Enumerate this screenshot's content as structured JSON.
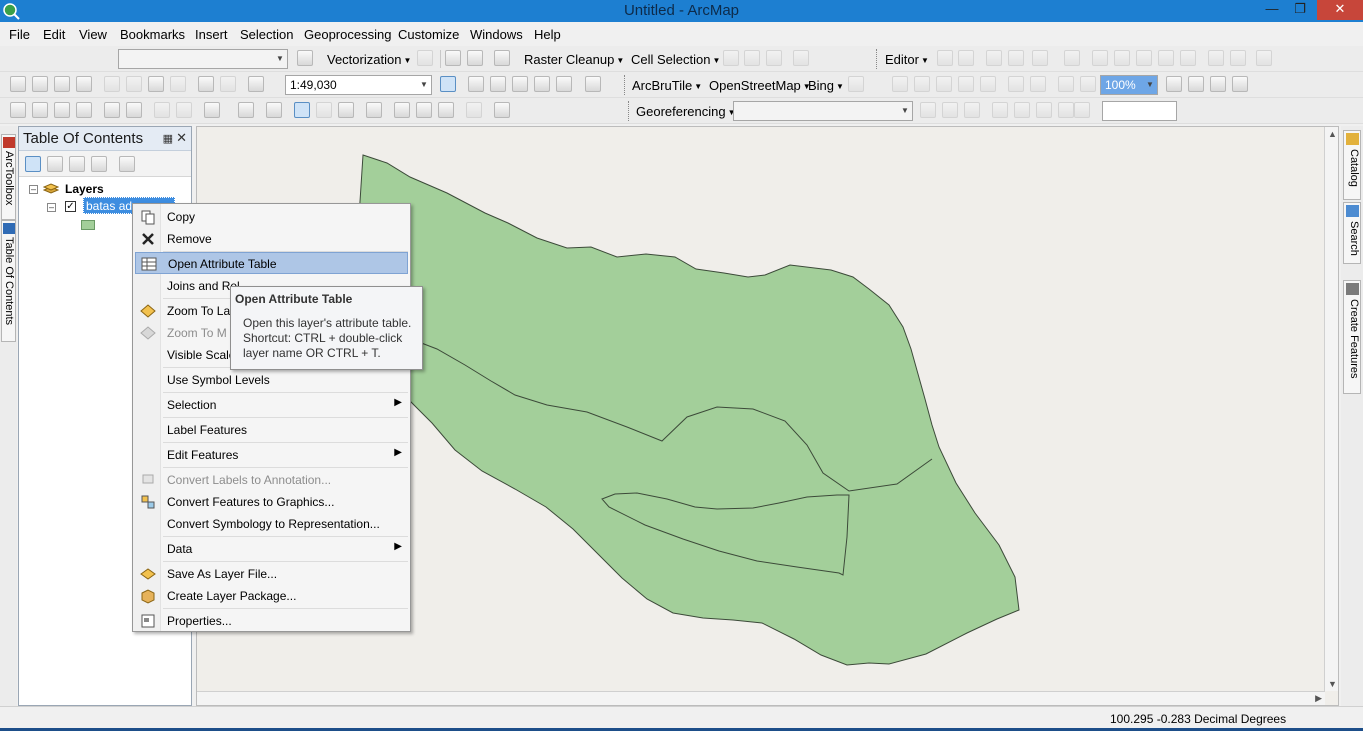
{
  "window": {
    "title": "Untitled - ArcMap"
  },
  "menu": [
    "File",
    "Edit",
    "View",
    "Bookmarks",
    "Insert",
    "Selection",
    "Geoprocessing",
    "Customize",
    "Windows",
    "Help"
  ],
  "toolbars": {
    "vectorization": "Vectorization",
    "raster_cleanup": "Raster Cleanup",
    "cell_selection": "Cell Selection",
    "editor": "Editor",
    "scale_value": "1:49,030",
    "arcbrutile": "ArcBruTile",
    "openstreetmap": "OpenStreetMap",
    "bing": "Bing",
    "zoom_percent": "100%",
    "georeferencing": "Georeferencing"
  },
  "left_tabs": [
    "ArcToolbox",
    "Table Of Contents"
  ],
  "toc": {
    "title": "Table Of Contents",
    "root": "Layers",
    "layer": "batas adm"
  },
  "right_tabs": [
    "Catalog",
    "Search",
    "Create Features"
  ],
  "context_menu": {
    "copy": "Copy",
    "remove": "Remove",
    "open_attribute_table": "Open Attribute Table",
    "joins": "Joins and Rel",
    "zoom_to_layer": "Zoom To La",
    "zoom_to_make_visible": "Zoom To M",
    "visible_scale": "Visible Scale",
    "use_symbol_levels": "Use Symbol Levels",
    "selection": "Selection",
    "label_features": "Label Features",
    "edit_features": "Edit Features",
    "convert_labels": "Convert Labels to Annotation...",
    "convert_features": "Convert Features to Graphics...",
    "convert_symbology": "Convert Symbology to Representation...",
    "data": "Data",
    "save_as_layer": "Save As Layer File...",
    "create_layer_package": "Create Layer Package...",
    "properties": "Properties..."
  },
  "tooltip": {
    "title": "Open Attribute Table",
    "body": "Open this layer's attribute table. Shortcut: CTRL + double-click layer name OR CTRL + T."
  },
  "status": {
    "coordinates": "100.295  -0.283 Decimal Degrees"
  },
  "colors": {
    "polygon_fill": "#a3cf9a",
    "polygon_stroke": "#3c4a39",
    "title_bar": "#1d7fd1",
    "selection": "#3d8de0"
  }
}
